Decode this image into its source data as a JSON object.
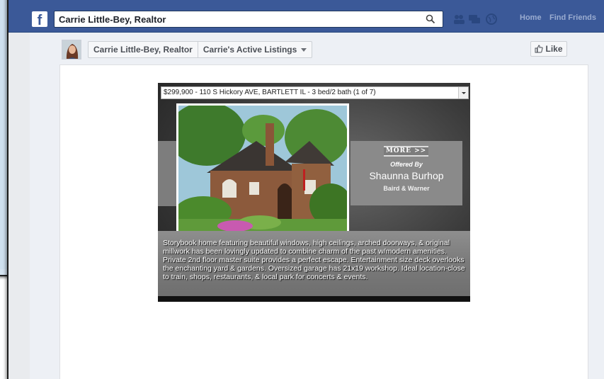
{
  "search": {
    "value": "Carrie Little-Bey, Realtor",
    "logo": "f"
  },
  "nav": {
    "home": "Home",
    "find_friends": "Find Friends"
  },
  "page_header": {
    "page_name": "Carrie Little-Bey, Realtor",
    "tab_name": "Carrie's Active Listings",
    "like_label": "Like"
  },
  "listing": {
    "selected_option": "$299,900 - 110 S Hickory AVE, BARTLETT IL - 3 bed/2 bath (1 of 7)",
    "more_label": "MORE >>",
    "offered_by": "Offered By",
    "agent_name": "Shaunna Burhop",
    "agent_company": "Baird & Warner",
    "description": "Storybook home featuring beautiful windows, high ceilings, arched doorways, & original millwork has been lovingly updated to combine charm of the past w/modern amenities. Private 2nd floor master suite provides a perfect escape.  Entertainment size deck overlooks the enchanting yard & gardens.  Oversized garage has 21x19 workshop. Ideal location-close to train, shops, restaurants, & local park for concerts & events."
  },
  "colors": {
    "fb_blue": "#3b5998",
    "page_bg": "#edf0f5"
  },
  "icons": [
    "facebook-logo-icon",
    "search-icon",
    "friends-icon",
    "messages-icon",
    "globe-icon",
    "thumb-up-icon",
    "caret-down-icon"
  ]
}
